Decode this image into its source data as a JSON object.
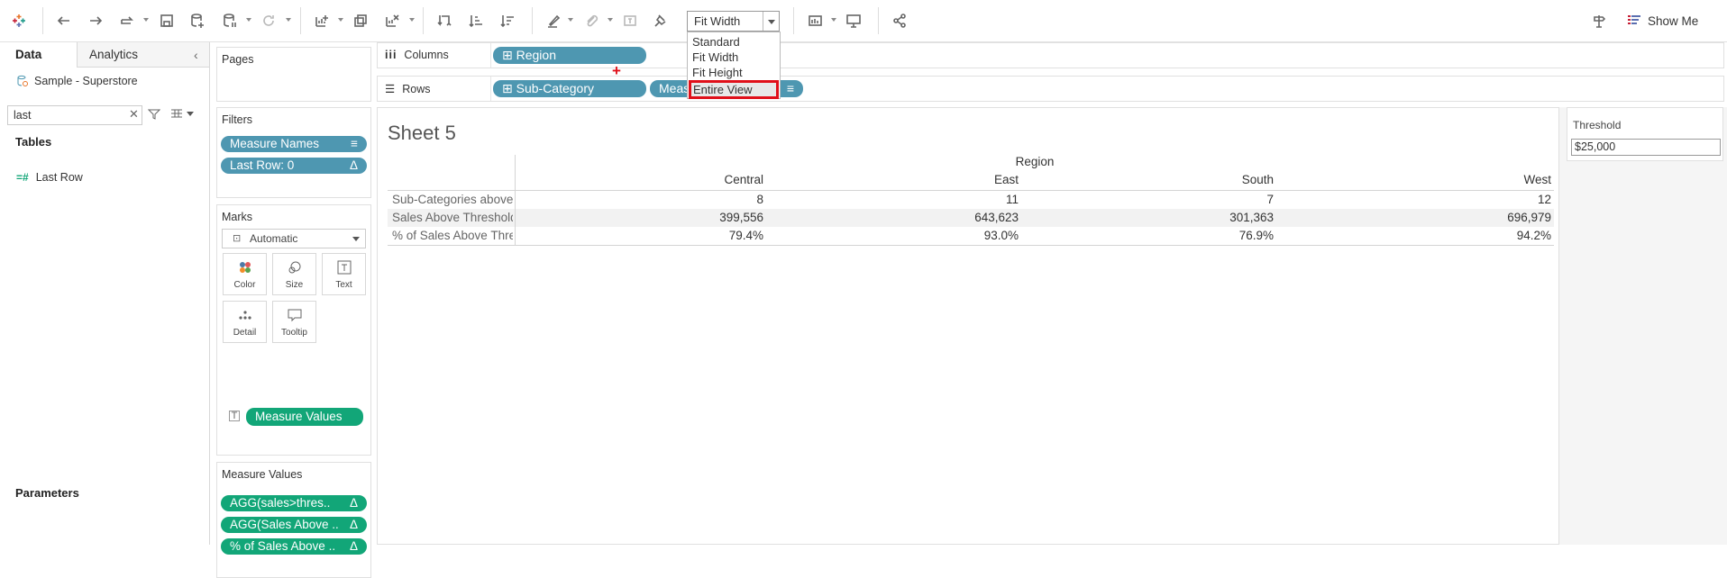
{
  "toolbar": {
    "fit_value": "Fit Width",
    "fit_options": [
      "Standard",
      "Fit Width",
      "Fit Height",
      "Entire View"
    ],
    "fit_selected_index": 3,
    "show_me_label": "Show Me"
  },
  "left": {
    "tab_data": "Data",
    "tab_analytics": "Analytics",
    "datasource": "Sample - Superstore",
    "search_value": "last",
    "tables_title": "Tables",
    "field": "Last Row",
    "parameters_title": "Parameters"
  },
  "cards": {
    "pages": "Pages",
    "filters": "Filters",
    "filter_pills": [
      "Measure Names",
      "Last Row: 0"
    ],
    "marks": "Marks",
    "marks_type": "Automatic",
    "mark_buttons": [
      "Color",
      "Size",
      "Text",
      "Detail",
      "Tooltip"
    ],
    "marks_pill": "Measure Values",
    "measure_values_title": "Measure Values",
    "measure_pills": [
      "AGG(sales>thres..",
      "AGG(Sales Above ..",
      "% of Sales Above .."
    ]
  },
  "shelves": {
    "columns_label": "Columns",
    "rows_label": "Rows",
    "columns_pill": "Region",
    "rows_pills": [
      "Sub-Category",
      "Meas"
    ]
  },
  "sheet": {
    "title": "Sheet 5",
    "column_header": "Region",
    "columns": [
      "Central",
      "East",
      "South",
      "West"
    ],
    "rows": [
      {
        "label": "Sub-Categories above..",
        "values": [
          "8",
          "11",
          "7",
          "12"
        ]
      },
      {
        "label": "Sales Above Threshold",
        "values": [
          "399,556",
          "643,623",
          "301,363",
          "696,979"
        ]
      },
      {
        "label": "% of Sales Above Thre..",
        "values": [
          "79.4%",
          "93.0%",
          "76.9%",
          "94.2%"
        ]
      }
    ]
  },
  "parameter": {
    "title": "Threshold",
    "value": "$25,000"
  },
  "colors": {
    "dimension_pill": "#4e97b1",
    "measure_pill": "#12a678",
    "highlight": "#e0101a"
  }
}
